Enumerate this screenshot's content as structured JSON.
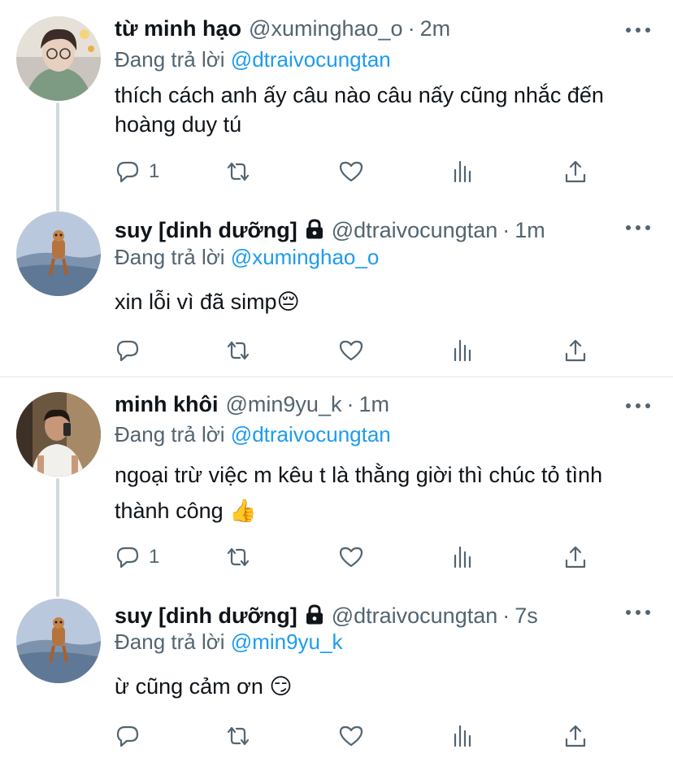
{
  "tweets": [
    {
      "name": "từ minh hạo",
      "handle": "@xuminghao_o",
      "dot": "·",
      "time": "2m",
      "reply_prefix": "Đang trả lời",
      "reply_to": "@dtraivocungtan",
      "text": "thích cách anh ấy câu nào câu nấy cũng nhắc đến hoàng duy tú",
      "reply_count": "1",
      "locked": false
    },
    {
      "name": "suy [dinh dưỡng]",
      "handle": "@dtraivocungtan",
      "dot": "·",
      "time": "1m",
      "reply_prefix": "Đang trả lời",
      "reply_to": "@xuminghao_o",
      "text": "xin lỗi vì đã simp😔",
      "reply_count": "",
      "locked": true
    },
    {
      "name": "minh khôi",
      "handle": "@min9yu_k",
      "dot": "·",
      "time": "1m",
      "reply_prefix": "Đang trả lời",
      "reply_to": "@dtraivocungtan",
      "text": "ngoại trừ việc m kêu t là thằng giời thì chúc tỏ tình thành công 👍",
      "reply_count": "1",
      "locked": false
    },
    {
      "name": "suy [dinh dưỡng]",
      "handle": "@dtraivocungtan",
      "dot": "·",
      "time": "7s",
      "reply_prefix": "Đang trả lời",
      "reply_to": "@min9yu_k",
      "text": "ừ cũng cảm ơn 😏",
      "reply_count": "",
      "locked": true
    }
  ],
  "icons": [
    "reply-icon",
    "retweet-icon",
    "like-icon",
    "views-icon",
    "share-icon",
    "lock-icon",
    "more-icon"
  ],
  "colors": {
    "link": "#1d9bf0",
    "secondary": "#536471",
    "text": "#0f1419",
    "thread_line": "#cfd9de"
  }
}
